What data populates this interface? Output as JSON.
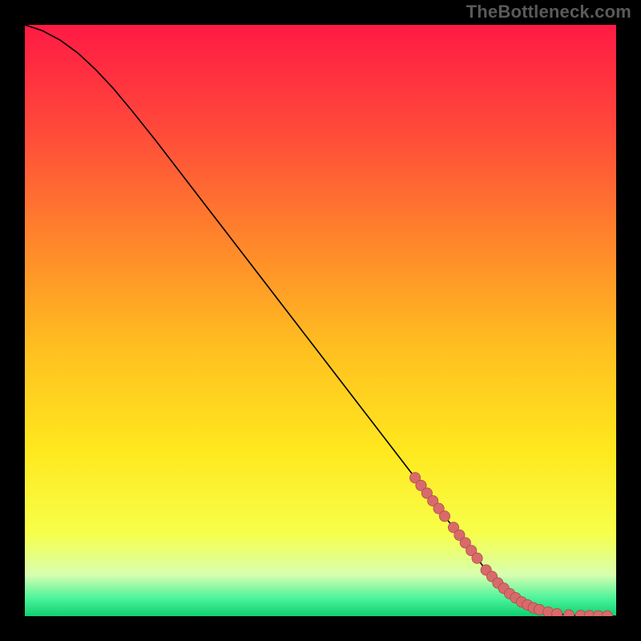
{
  "watermark": "TheBottleneck.com",
  "colors": {
    "page_bg": "#000000",
    "curve": "#000000",
    "marker_fill": "#d96a6a",
    "marker_stroke": "#a64a4a",
    "gradient_stops": [
      {
        "offset": "0%",
        "color": "#ff1a44"
      },
      {
        "offset": "18%",
        "color": "#ff4a3a"
      },
      {
        "offset": "38%",
        "color": "#ff8a2a"
      },
      {
        "offset": "55%",
        "color": "#ffc020"
      },
      {
        "offset": "72%",
        "color": "#ffe81e"
      },
      {
        "offset": "86%",
        "color": "#f7ff4a"
      },
      {
        "offset": "93%",
        "color": "#d8ffb0"
      },
      {
        "offset": "97%",
        "color": "#4bf39a"
      },
      {
        "offset": "100%",
        "color": "#0fd070"
      }
    ]
  },
  "chart_data": {
    "type": "line",
    "title": "",
    "xlabel": "",
    "ylabel": "",
    "xlim": [
      0,
      100
    ],
    "ylim": [
      0,
      100
    ],
    "series": [
      {
        "name": "curve",
        "x": [
          0,
          3,
          6,
          9,
          12,
          15,
          18,
          22,
          26,
          30,
          34,
          38,
          42,
          46,
          50,
          54,
          58,
          62,
          66,
          70,
          74,
          78,
          80,
          82,
          84,
          86,
          88,
          90,
          92,
          94,
          96,
          98,
          100
        ],
        "y": [
          100,
          99.0,
          97.4,
          95.2,
          92.4,
          89.2,
          85.6,
          80.6,
          75.4,
          70.2,
          65.0,
          59.8,
          54.6,
          49.4,
          44.2,
          39.0,
          33.8,
          28.6,
          23.4,
          18.2,
          13.0,
          7.8,
          5.6,
          3.8,
          2.4,
          1.4,
          0.8,
          0.4,
          0.2,
          0.1,
          0.05,
          0.02,
          0.0
        ]
      }
    ],
    "markers": {
      "name": "highlighted-range",
      "x": [
        66,
        67,
        68,
        69,
        70,
        71,
        72.5,
        73.5,
        74.5,
        75.5,
        76.5,
        78,
        79,
        80,
        81,
        82,
        83,
        84,
        85,
        86,
        87,
        88.5,
        90,
        92,
        94,
        95.5,
        97,
        98.5
      ],
      "y": [
        23.4,
        22.1,
        20.8,
        19.5,
        18.2,
        16.9,
        15.0,
        13.7,
        12.4,
        11.1,
        9.8,
        7.8,
        6.7,
        5.6,
        4.7,
        3.8,
        3.1,
        2.4,
        1.9,
        1.4,
        1.1,
        0.7,
        0.4,
        0.2,
        0.12,
        0.08,
        0.05,
        0.03
      ]
    }
  }
}
